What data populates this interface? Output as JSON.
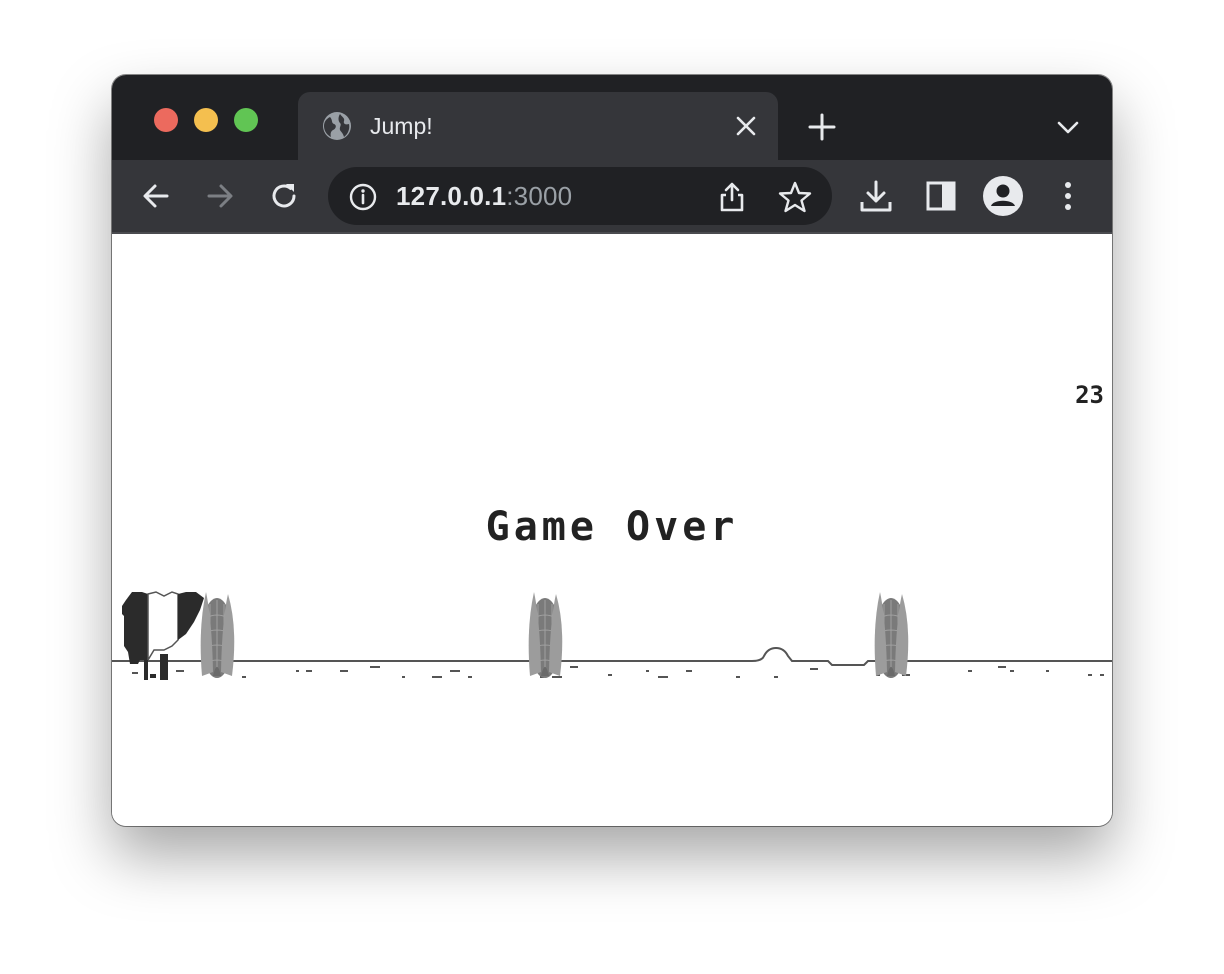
{
  "window_controls": [
    "close",
    "minimize",
    "zoom"
  ],
  "tab": {
    "title": "Jump!",
    "icon": "globe-icon"
  },
  "toolbar": {
    "back_icon": "back-arrow-icon",
    "forward_icon": "forward-arrow-icon",
    "reload_icon": "reload-icon"
  },
  "address_bar": {
    "host": "127.0.0.1",
    "port": ":3000",
    "info_icon": "info-icon"
  },
  "game": {
    "score": "23",
    "message": "Game Over",
    "player": "skunk-character",
    "obstacles": [
      "corn-obstacle",
      "corn-obstacle",
      "corn-obstacle"
    ]
  },
  "colors": {
    "chrome_dark": "#202124",
    "chrome_tab": "#35363a",
    "close_red": "#ec6a5e",
    "minimize_yellow": "#f4bf4f",
    "zoom_green": "#61c554"
  }
}
